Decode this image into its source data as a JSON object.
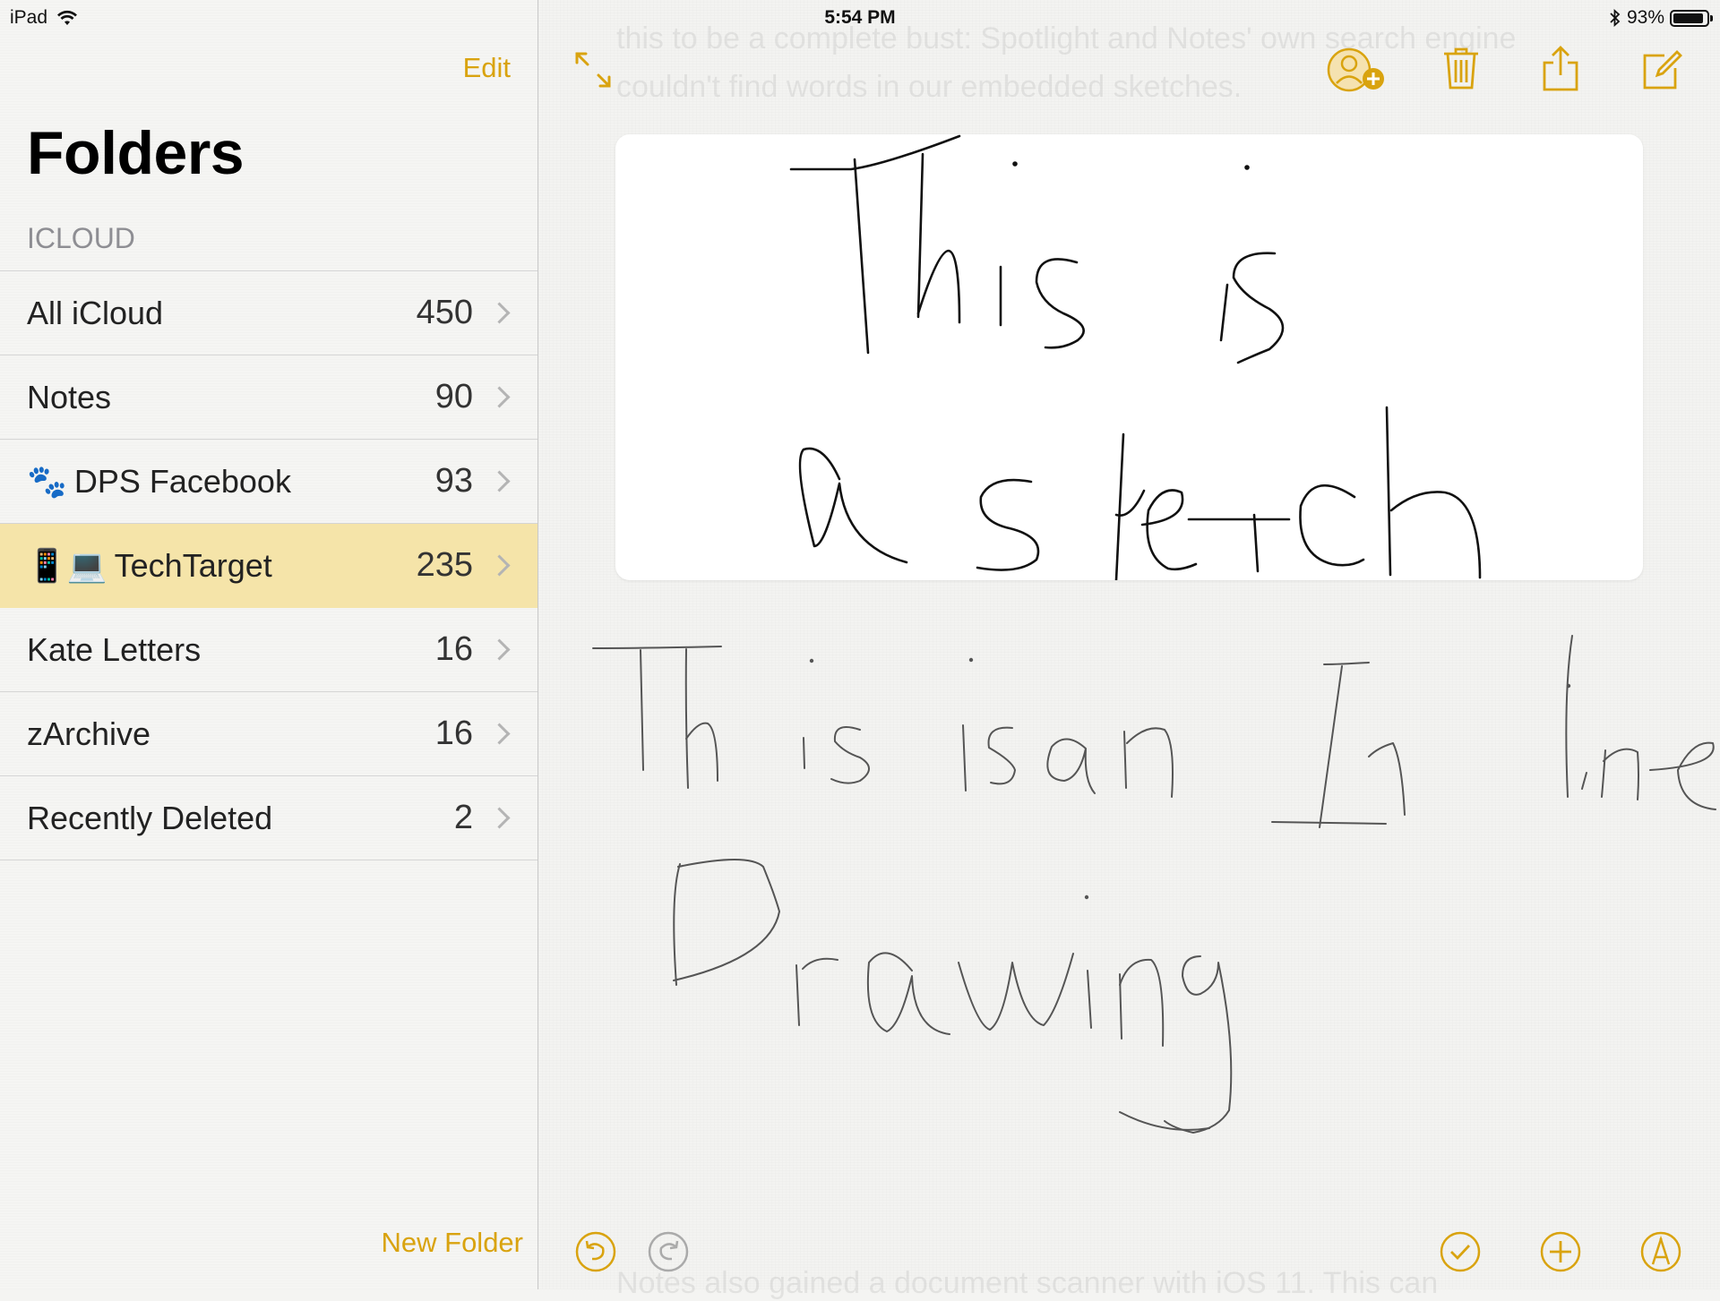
{
  "status_bar": {
    "device": "iPad",
    "time": "5:54 PM",
    "battery": "93%",
    "battery_level": 0.93
  },
  "sidebar": {
    "edit_label": "Edit",
    "title": "Folders",
    "section": "ICLOUD",
    "folders": [
      {
        "name": "All iCloud",
        "count": "450",
        "emoji": "",
        "selected": false
      },
      {
        "name": "Notes",
        "count": "90",
        "emoji": "",
        "selected": false
      },
      {
        "name": "DPS Facebook",
        "count": "93",
        "emoji": "🐾",
        "selected": false
      },
      {
        "name": "TechTarget",
        "count": "235",
        "emoji": "📱💻",
        "selected": true
      },
      {
        "name": "Kate Letters",
        "count": "16",
        "emoji": "",
        "selected": false
      },
      {
        "name": "zArchive",
        "count": "16",
        "emoji": "",
        "selected": false
      },
      {
        "name": "Recently Deleted",
        "count": "2",
        "emoji": "",
        "selected": false
      }
    ],
    "new_folder_label": "New Folder"
  },
  "note": {
    "ghost_text_top": "this to be a complete bust: Spotlight and Notes' own search engine couldn't find words in our embedded sketches.",
    "ghost_line1": "this to be a complete bust: Spotlight and Notes' own search engine",
    "ghost_line2": "couldn't find words in our embedded sketches.",
    "ghost_bottom": "Notes also gained a document scanner with iOS 11. This can",
    "sketch_text": "This is a sketch",
    "inline_text": "This is an Inline Drawing"
  },
  "colors": {
    "accent": "#d9a30f",
    "selected_row": "#f5e4a9"
  },
  "icons": {
    "toolbar_top": [
      "expand-icon",
      "add-person-icon",
      "trash-icon",
      "share-icon",
      "compose-icon"
    ],
    "toolbar_bottom": [
      "undo-icon",
      "redo-icon",
      "checklist-icon",
      "add-icon",
      "markup-icon"
    ]
  }
}
